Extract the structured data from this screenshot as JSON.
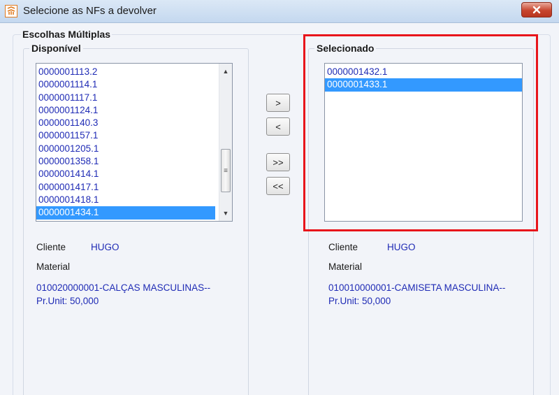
{
  "window": {
    "title": "Selecione as NFs a devolver",
    "close_symbol": "✕"
  },
  "group": {
    "title": "Escolhas Múltiplas"
  },
  "left": {
    "title": "Disponível",
    "items": [
      "0000001113.2",
      "0000001114.1",
      "0000001117.1",
      "0000001124.1",
      "0000001140.3",
      "0000001157.1",
      "0000001205.1",
      "0000001358.1",
      "0000001414.1",
      "0000001417.1",
      "0000001418.1",
      "0000001434.1"
    ],
    "selected_item": "0000001434.1",
    "cliente_label": "Cliente",
    "cliente_value": "HUGO",
    "material_label": "Material",
    "material_line1": "010020000001-CALÇAS MASCULINAS--",
    "material_line2": "Pr.Unit: 50,000"
  },
  "right": {
    "title": "Selecionado",
    "items": [
      "0000001432.1",
      "0000001433.1"
    ],
    "selected_item": "0000001433.1",
    "cliente_label": "Cliente",
    "cliente_value": "HUGO",
    "material_label": "Material",
    "material_line1": "010010000001-CAMISETA MASCULINA--",
    "material_line2": "Pr.Unit: 50,000"
  },
  "buttons": {
    "add": ">",
    "remove": "<",
    "add_all": ">>",
    "remove_all": "<<"
  },
  "icons": {
    "app": "app-logo-icon",
    "scroll_up": "▲",
    "scroll_down": "▼",
    "thumb_grip": "≡"
  },
  "colors": {
    "list_text": "#1f2bb5",
    "selection": "#3399ff",
    "highlight_box": "#e8151b"
  }
}
